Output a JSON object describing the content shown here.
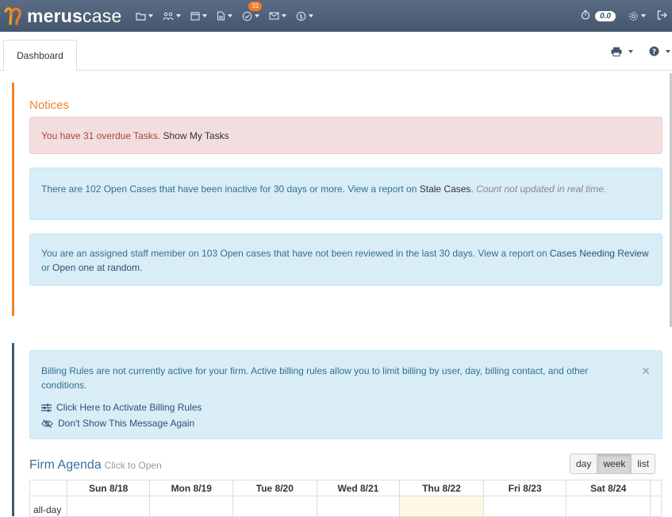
{
  "app": {
    "logo_text_bold": "merus",
    "logo_text_light": "case",
    "tasks_badge": "31",
    "timer_value": "0.0"
  },
  "nav": {
    "icons": [
      "folder-icon",
      "people-icon",
      "calendar-icon",
      "document-icon",
      "tasks-icon",
      "mail-icon",
      "billing-icon"
    ],
    "right_icons": [
      "stopwatch-icon",
      "settings-icon",
      "logout-icon"
    ]
  },
  "tabs": [
    {
      "label": "Dashboard"
    }
  ],
  "notices": {
    "title": "Notices",
    "overdue": {
      "text": "You have 31 overdue Tasks.",
      "link": "Show My Tasks"
    },
    "stale": {
      "text": "There are 102 Open Cases that have been inactive for 30 days or more. View a report on",
      "link": "Stale Cases",
      "note": "Count not updated in real time."
    },
    "review": {
      "text": "You are an assigned staff member on 103 Open cases that have not been reviewed in the last 30 days. View a report on",
      "link1": "Cases Needing Review",
      "mid": "or",
      "link2": "Open one at random."
    }
  },
  "billing": {
    "message": "Billing Rules are not currently active for your firm. Active billing rules allow you to limit billing by user, day, billing contact, and other conditions.",
    "activate": "Click Here to Activate Billing Rules",
    "dismiss": "Don't Show This Message Again"
  },
  "agenda": {
    "title": "Firm Agenda",
    "hint": "Click to Open",
    "views": [
      "day",
      "week",
      "list"
    ],
    "active_view": "week",
    "days": [
      "Sun 8/18",
      "Mon 8/19",
      "Tue 8/20",
      "Wed 8/21",
      "Thu 8/22",
      "Fri 8/23",
      "Sat 8/24"
    ],
    "allday_label": "all-day"
  },
  "colors": {
    "nav_bg": "#4f627a",
    "notice_accent": "#f0842c",
    "billing_accent": "#3d5a73",
    "today_bg": "#fcf8e3"
  }
}
